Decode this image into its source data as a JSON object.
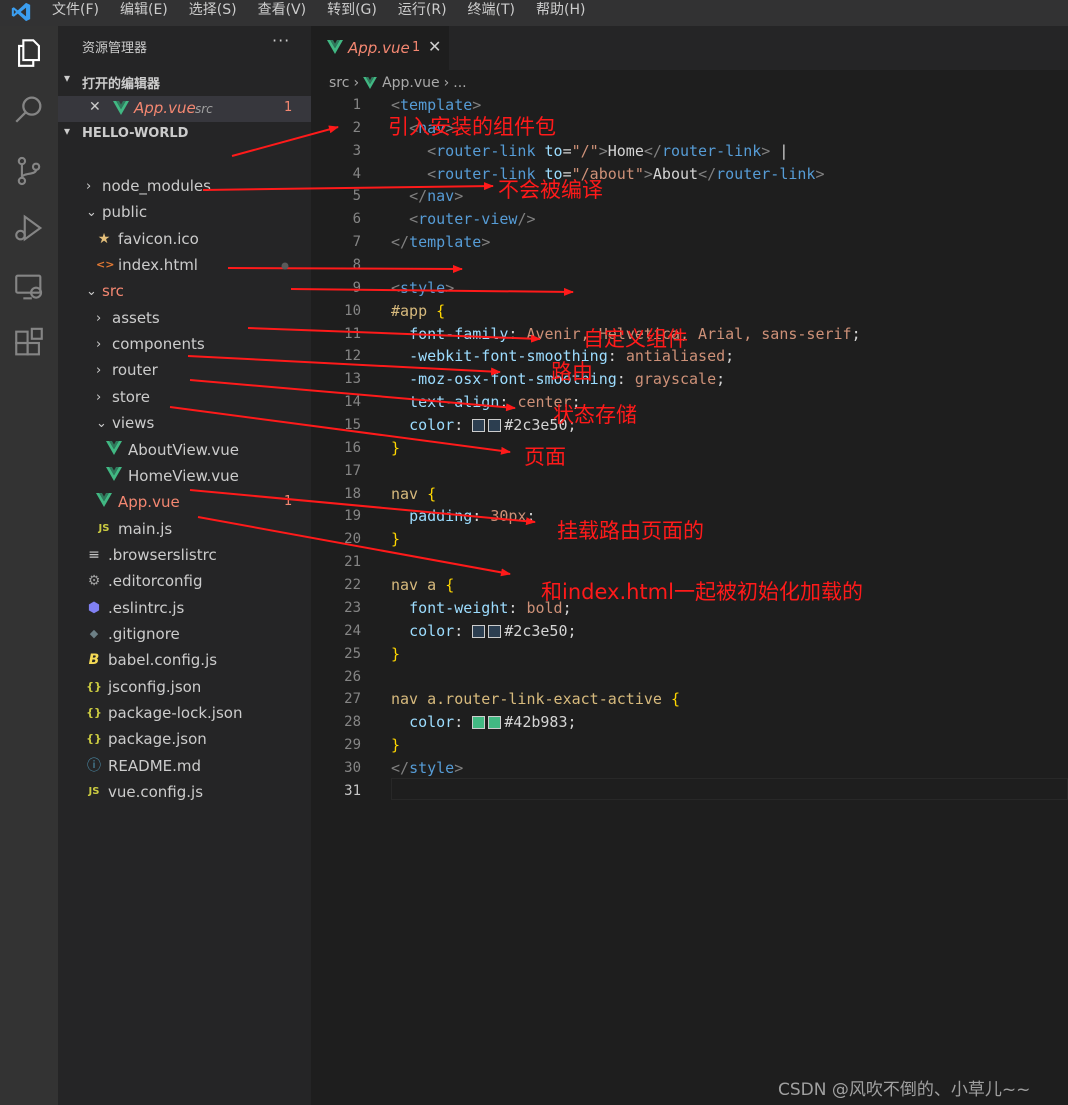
{
  "menu": [
    "文件(F)",
    "编辑(E)",
    "选择(S)",
    "查看(V)",
    "转到(G)",
    "运行(R)",
    "终端(T)",
    "帮助(H)"
  ],
  "explorer": {
    "title": "资源管理器",
    "more": "···",
    "open_editors": {
      "label": "打开的编辑器",
      "file": "App.vue",
      "folder": "src",
      "badge": "1"
    },
    "project": "HELLO-WORLD",
    "tree": [
      {
        "name": "node_modules",
        "type": "folder",
        "collapsed": true
      },
      {
        "name": "public",
        "type": "folder",
        "collapsed": false
      },
      {
        "name": "favicon.ico",
        "type": "star"
      },
      {
        "name": "index.html",
        "type": "html"
      },
      {
        "name": "src",
        "type": "folder",
        "collapsed": false,
        "modified": true
      },
      {
        "name": "assets",
        "type": "folder",
        "collapsed": true
      },
      {
        "name": "components",
        "type": "folder",
        "collapsed": true
      },
      {
        "name": "router",
        "type": "folder",
        "collapsed": true
      },
      {
        "name": "store",
        "type": "folder",
        "collapsed": true
      },
      {
        "name": "views",
        "type": "folder",
        "collapsed": false
      },
      {
        "name": "AboutView.vue",
        "type": "vue"
      },
      {
        "name": "HomeView.vue",
        "type": "vue"
      },
      {
        "name": "App.vue",
        "type": "vue",
        "modified": true,
        "badge": "1"
      },
      {
        "name": "main.js",
        "type": "js"
      },
      {
        "name": ".browserslistrc",
        "type": "lines"
      },
      {
        "name": ".editorconfig",
        "type": "gear"
      },
      {
        "name": ".eslintrc.js",
        "type": "eslint"
      },
      {
        "name": ".gitignore",
        "type": "git"
      },
      {
        "name": "babel.config.js",
        "type": "babel"
      },
      {
        "name": "jsconfig.json",
        "type": "json"
      },
      {
        "name": "package-lock.json",
        "type": "json"
      },
      {
        "name": "package.json",
        "type": "json"
      },
      {
        "name": "README.md",
        "type": "info"
      },
      {
        "name": "vue.config.js",
        "type": "js"
      }
    ]
  },
  "tab": {
    "label": "App.vue",
    "badge": "1",
    "close": "✕"
  },
  "breadcrumb": {
    "folder": "src",
    "file": "App.vue",
    "more": "..."
  },
  "code_lines": [
    "<template>",
    "  <nav>",
    "    <router-link to=\"/\">Home</router-link> |",
    "    <router-link to=\"/about\">About</router-link>",
    "  </nav>",
    "  <router-view/>",
    "</template>",
    "",
    "<style>",
    "#app {",
    "  font-family: Avenir, Helvetica, Arial, sans-serif;",
    "  -webkit-font-smoothing: antialiased;",
    "  -moz-osx-font-smoothing: grayscale;",
    "  text-align: center;",
    "  color: #2c3e50;",
    "}",
    "",
    "nav {",
    "  padding: 30px;",
    "}",
    "",
    "nav a {",
    "  font-weight: bold;",
    "  color: #2c3e50;",
    "}",
    "",
    "nav a.router-link-exact-active {",
    "  color: #42b983;",
    "}",
    "</style>",
    ""
  ],
  "annotations": [
    {
      "text": "引入安装的组件包"
    },
    {
      "text": "不会被编译"
    },
    {
      "text": "自定义组件"
    },
    {
      "text": "路由"
    },
    {
      "text": "状态存储"
    },
    {
      "text": "页面"
    },
    {
      "text": "挂载路由页面的"
    },
    {
      "text": "和index.html一起被初始化加载的"
    }
  ],
  "watermark": "CSDN @风吹不倒的、小草儿~~",
  "colors": {
    "annotation": "#ff1a1a",
    "swatch_dark": "#2c3e50",
    "swatch_green": "#42b983",
    "modified": "#f48771"
  }
}
